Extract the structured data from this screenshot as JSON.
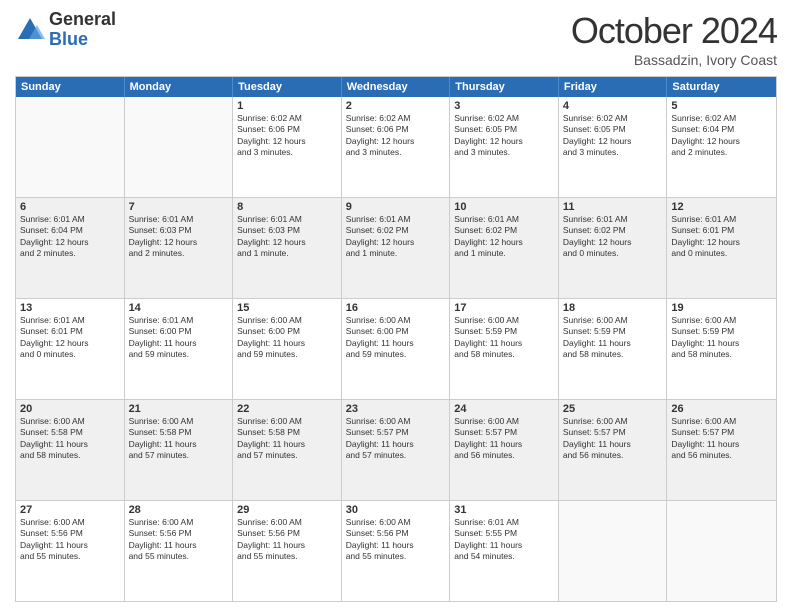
{
  "header": {
    "logo_general": "General",
    "logo_blue": "Blue",
    "month_title": "October 2024",
    "subtitle": "Bassadzin, Ivory Coast"
  },
  "days_of_week": [
    "Sunday",
    "Monday",
    "Tuesday",
    "Wednesday",
    "Thursday",
    "Friday",
    "Saturday"
  ],
  "rows": [
    [
      {
        "num": "",
        "text": "",
        "empty": true
      },
      {
        "num": "",
        "text": "",
        "empty": true
      },
      {
        "num": "1",
        "text": "Sunrise: 6:02 AM\nSunset: 6:06 PM\nDaylight: 12 hours\nand 3 minutes."
      },
      {
        "num": "2",
        "text": "Sunrise: 6:02 AM\nSunset: 6:06 PM\nDaylight: 12 hours\nand 3 minutes."
      },
      {
        "num": "3",
        "text": "Sunrise: 6:02 AM\nSunset: 6:05 PM\nDaylight: 12 hours\nand 3 minutes."
      },
      {
        "num": "4",
        "text": "Sunrise: 6:02 AM\nSunset: 6:05 PM\nDaylight: 12 hours\nand 3 minutes."
      },
      {
        "num": "5",
        "text": "Sunrise: 6:02 AM\nSunset: 6:04 PM\nDaylight: 12 hours\nand 2 minutes."
      }
    ],
    [
      {
        "num": "6",
        "text": "Sunrise: 6:01 AM\nSunset: 6:04 PM\nDaylight: 12 hours\nand 2 minutes.",
        "shaded": true
      },
      {
        "num": "7",
        "text": "Sunrise: 6:01 AM\nSunset: 6:03 PM\nDaylight: 12 hours\nand 2 minutes.",
        "shaded": true
      },
      {
        "num": "8",
        "text": "Sunrise: 6:01 AM\nSunset: 6:03 PM\nDaylight: 12 hours\nand 1 minute.",
        "shaded": true
      },
      {
        "num": "9",
        "text": "Sunrise: 6:01 AM\nSunset: 6:02 PM\nDaylight: 12 hours\nand 1 minute.",
        "shaded": true
      },
      {
        "num": "10",
        "text": "Sunrise: 6:01 AM\nSunset: 6:02 PM\nDaylight: 12 hours\nand 1 minute.",
        "shaded": true
      },
      {
        "num": "11",
        "text": "Sunrise: 6:01 AM\nSunset: 6:02 PM\nDaylight: 12 hours\nand 0 minutes.",
        "shaded": true
      },
      {
        "num": "12",
        "text": "Sunrise: 6:01 AM\nSunset: 6:01 PM\nDaylight: 12 hours\nand 0 minutes.",
        "shaded": true
      }
    ],
    [
      {
        "num": "13",
        "text": "Sunrise: 6:01 AM\nSunset: 6:01 PM\nDaylight: 12 hours\nand 0 minutes."
      },
      {
        "num": "14",
        "text": "Sunrise: 6:01 AM\nSunset: 6:00 PM\nDaylight: 11 hours\nand 59 minutes."
      },
      {
        "num": "15",
        "text": "Sunrise: 6:00 AM\nSunset: 6:00 PM\nDaylight: 11 hours\nand 59 minutes."
      },
      {
        "num": "16",
        "text": "Sunrise: 6:00 AM\nSunset: 6:00 PM\nDaylight: 11 hours\nand 59 minutes."
      },
      {
        "num": "17",
        "text": "Sunrise: 6:00 AM\nSunset: 5:59 PM\nDaylight: 11 hours\nand 58 minutes."
      },
      {
        "num": "18",
        "text": "Sunrise: 6:00 AM\nSunset: 5:59 PM\nDaylight: 11 hours\nand 58 minutes."
      },
      {
        "num": "19",
        "text": "Sunrise: 6:00 AM\nSunset: 5:59 PM\nDaylight: 11 hours\nand 58 minutes."
      }
    ],
    [
      {
        "num": "20",
        "text": "Sunrise: 6:00 AM\nSunset: 5:58 PM\nDaylight: 11 hours\nand 58 minutes.",
        "shaded": true
      },
      {
        "num": "21",
        "text": "Sunrise: 6:00 AM\nSunset: 5:58 PM\nDaylight: 11 hours\nand 57 minutes.",
        "shaded": true
      },
      {
        "num": "22",
        "text": "Sunrise: 6:00 AM\nSunset: 5:58 PM\nDaylight: 11 hours\nand 57 minutes.",
        "shaded": true
      },
      {
        "num": "23",
        "text": "Sunrise: 6:00 AM\nSunset: 5:57 PM\nDaylight: 11 hours\nand 57 minutes.",
        "shaded": true
      },
      {
        "num": "24",
        "text": "Sunrise: 6:00 AM\nSunset: 5:57 PM\nDaylight: 11 hours\nand 56 minutes.",
        "shaded": true
      },
      {
        "num": "25",
        "text": "Sunrise: 6:00 AM\nSunset: 5:57 PM\nDaylight: 11 hours\nand 56 minutes.",
        "shaded": true
      },
      {
        "num": "26",
        "text": "Sunrise: 6:00 AM\nSunset: 5:57 PM\nDaylight: 11 hours\nand 56 minutes.",
        "shaded": true
      }
    ],
    [
      {
        "num": "27",
        "text": "Sunrise: 6:00 AM\nSunset: 5:56 PM\nDaylight: 11 hours\nand 55 minutes."
      },
      {
        "num": "28",
        "text": "Sunrise: 6:00 AM\nSunset: 5:56 PM\nDaylight: 11 hours\nand 55 minutes."
      },
      {
        "num": "29",
        "text": "Sunrise: 6:00 AM\nSunset: 5:56 PM\nDaylight: 11 hours\nand 55 minutes."
      },
      {
        "num": "30",
        "text": "Sunrise: 6:00 AM\nSunset: 5:56 PM\nDaylight: 11 hours\nand 55 minutes."
      },
      {
        "num": "31",
        "text": "Sunrise: 6:01 AM\nSunset: 5:55 PM\nDaylight: 11 hours\nand 54 minutes."
      },
      {
        "num": "",
        "text": "",
        "empty": true
      },
      {
        "num": "",
        "text": "",
        "empty": true
      }
    ]
  ]
}
